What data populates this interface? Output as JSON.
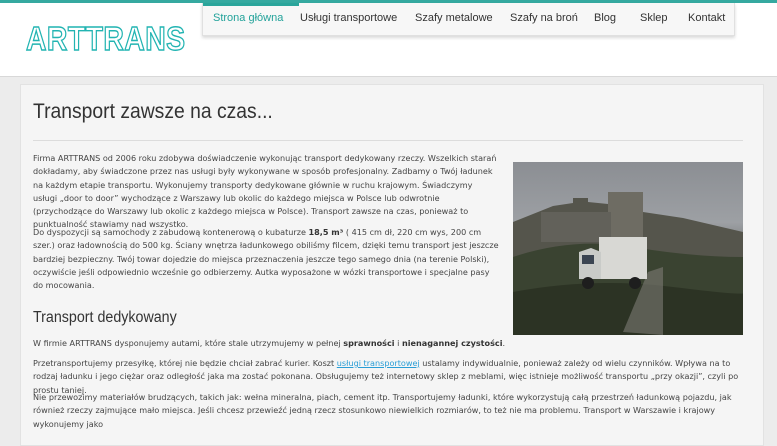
{
  "logo": "ARTTRANS",
  "nav": {
    "items": [
      "Strona główna",
      "Usługi transportowe",
      "Szafy metalowe",
      "Szafy na broń",
      "Blog",
      "Sklep",
      "Kontakt"
    ]
  },
  "main": {
    "title": "Transport zawsze na czas...",
    "p1": "Firma ARTTRANS od 2006 roku zdobywa doświadczenie wykonując transport dedykowany rzeczy. Wszelkich starań dokładamy, aby świadczone przez nas usługi były wykonywane w sposób profesjonalny. Zadbamy o Twój ładunek na każdym etapie transportu. Wykonujemy transporty dedykowane głównie w ruchu krajowym. Świadczymy usługi „door to door” wychodzące z Warszawy lub okolic do każdego miejsca w Polsce lub odwrotnie (przychodzące do Warszawy lub okolic z każdego miejsca w Polsce). Transport zawsze na czas, ponieważ to punktualność stawiamy nad wszystko.",
    "p2_a": "Do dyspozycji są samochody z zabudową kontenerową o kubaturze ",
    "p2_bold": "18,5 m³",
    "p2_b": " ( 415 cm dł, 220 cm wys, 200 cm szer.) oraz ładownością do 500 kg. Ściany wnętrza ładunkowego obiliśmy filcem, dzięki temu transport jest jeszcze bardziej bezpieczny. Twój towar dojedzie do miejsca przeznaczenia jeszcze tego samego dnia (na terenie Polski), oczywiście jeśli odpowiednio wcześnie go odbierzemy. Autka wyposażone w wózki transportowe i specjalne pasy do mocowania.",
    "subtitle": "Transport dedykowany",
    "p3_a": "W firmie ARTTRANS dysponujemy autami, które stale utrzymujemy w pełnej ",
    "p3_bold1": "sprawności",
    "p3_mid": " i ",
    "p3_bold2": "nienagannej czystości",
    "p3_end": ".",
    "p4_a": "Przetransportujemy przesyłkę, której nie będzie chciał zabrać kurier. Koszt ",
    "p4_link": "usługi transportowej",
    "p4_b": " ustalamy indywidualnie, ponieważ zależy od wielu czynników. Wpływa na to rodzaj ładunku i jego ciężar oraz odległość jaka ma zostać pokonana. Obsługujemy też internetowy sklep z meblami, więc istnieje możliwość transportu „przy okazji”, czyli po prostu taniej.",
    "p5": "Nie przewozimy materiałów brudzących, takich jak: wełna mineralna, piach, cement itp. Transportujemy ładunki, które wykorzystują całą przestrzeń ładunkową pojazdu, jak również rzeczy zajmujące mało miejsca. Jeśli chcesz przewieźć jedną rzecz stosunkowo niewielkich rozmiarów, to też nie ma problemu. Transport w Warszawie i krajowy wykonujemy jako"
  }
}
